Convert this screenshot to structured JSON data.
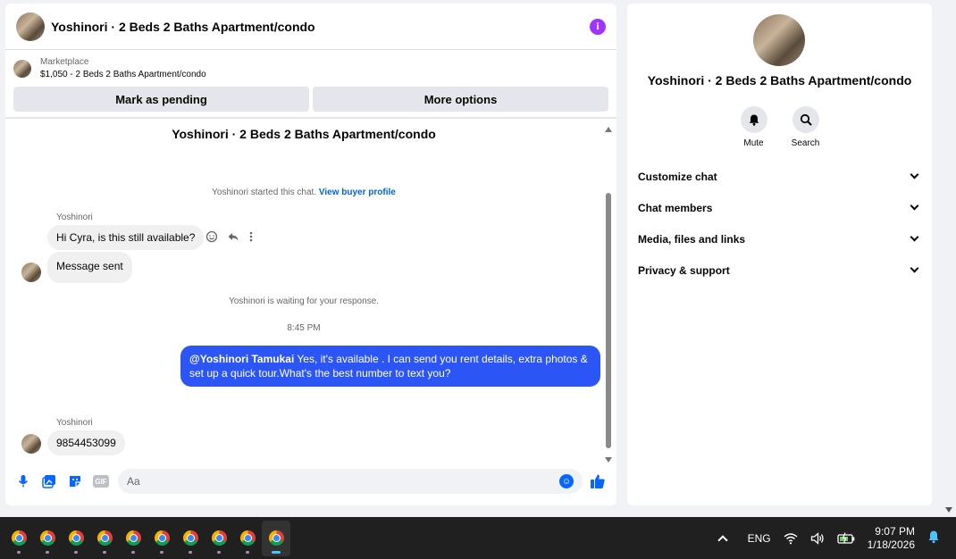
{
  "chat": {
    "header_title": "Yoshinori · 2 Beds 2 Baths Apartment/condo",
    "marketplace_label": "Marketplace",
    "marketplace_listing": "$1,050 - 2 Beds 2 Baths Apartment/condo",
    "mark_pending_label": "Mark as pending",
    "more_options_label": "More options",
    "conversation_title": "Yoshinori · 2 Beds 2 Baths Apartment/condo",
    "started_text": "Yoshinori started this chat.",
    "view_profile_link": "View buyer profile",
    "sender_name_1": "Yoshinori",
    "message_1": "Hi Cyra, is this still available?",
    "message_2": "Message sent",
    "waiting_text": "Yoshinori is waiting for your response.",
    "timestamp": "8:45 PM",
    "outgoing_mention": "@Yoshinori Tamukai",
    "outgoing_text": " Yes, it's available .  I can send you rent details, extra photos & set up a quick tour.What's the best number to text you?",
    "sender_name_2": "Yoshinori",
    "message_3": "9854453099",
    "composer_placeholder": "Aa",
    "gif_label": "GIF"
  },
  "info": {
    "title": "Yoshinori · 2 Beds 2 Baths Apartment/condo",
    "mute_label": "Mute",
    "search_label": "Search",
    "sections": [
      "Customize chat",
      "Chat members",
      "Media, files and links",
      "Privacy & support"
    ]
  },
  "taskbar": {
    "language": "ENG",
    "time": "9:07 PM",
    "date": "1/18/2026",
    "app_count": 10
  },
  "colors": {
    "accent": "#0866ff",
    "outgoing_bubble": "#2b55f5",
    "info_icon": "#a033ff"
  }
}
